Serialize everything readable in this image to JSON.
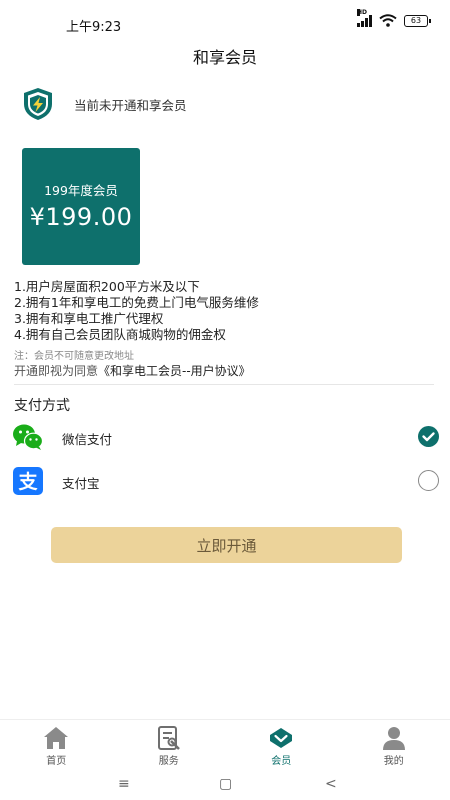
{
  "status_bar": {
    "time": "上午9:23",
    "network_badge": "HD",
    "battery": "63"
  },
  "header": {
    "title": "和享会员"
  },
  "member_status": {
    "text": "当前未开通和享会员"
  },
  "plan": {
    "name": "199年度会员",
    "price": "¥199.00"
  },
  "benefits": [
    "1.用户房屋面积200平方米及以下",
    "2.拥有1年和享电工的免费上门电气服务维修",
    "3.拥有和享电工推广代理权",
    "4.拥有自己会员团队商城购物的佣金权"
  ],
  "note": "注：会员不可随意更改地址",
  "agreement": {
    "prefix": "开通即视为同意",
    "link": "《和享电工会员--用户协议》"
  },
  "payment": {
    "title": "支付方式",
    "methods": [
      {
        "label": "微信支付",
        "icon": "wechat-pay-icon",
        "selected": true
      },
      {
        "label": "支付宝",
        "icon": "alipay-icon",
        "selected": false
      }
    ]
  },
  "open_button": {
    "label": "立即开通"
  },
  "bottom_nav": [
    {
      "label": "首页",
      "icon": "home-icon",
      "active": false
    },
    {
      "label": "服务",
      "icon": "service-icon",
      "active": false
    },
    {
      "label": "会员",
      "icon": "member-icon",
      "active": true
    },
    {
      "label": "我的",
      "icon": "profile-icon",
      "active": false
    }
  ],
  "system_nav": {
    "menu": "≡",
    "home": "▢",
    "back": "<"
  },
  "colors": {
    "accent": "#0e706c",
    "button": "#ecd39a",
    "wechat": "#1aad19",
    "alipay": "#1677ff"
  }
}
